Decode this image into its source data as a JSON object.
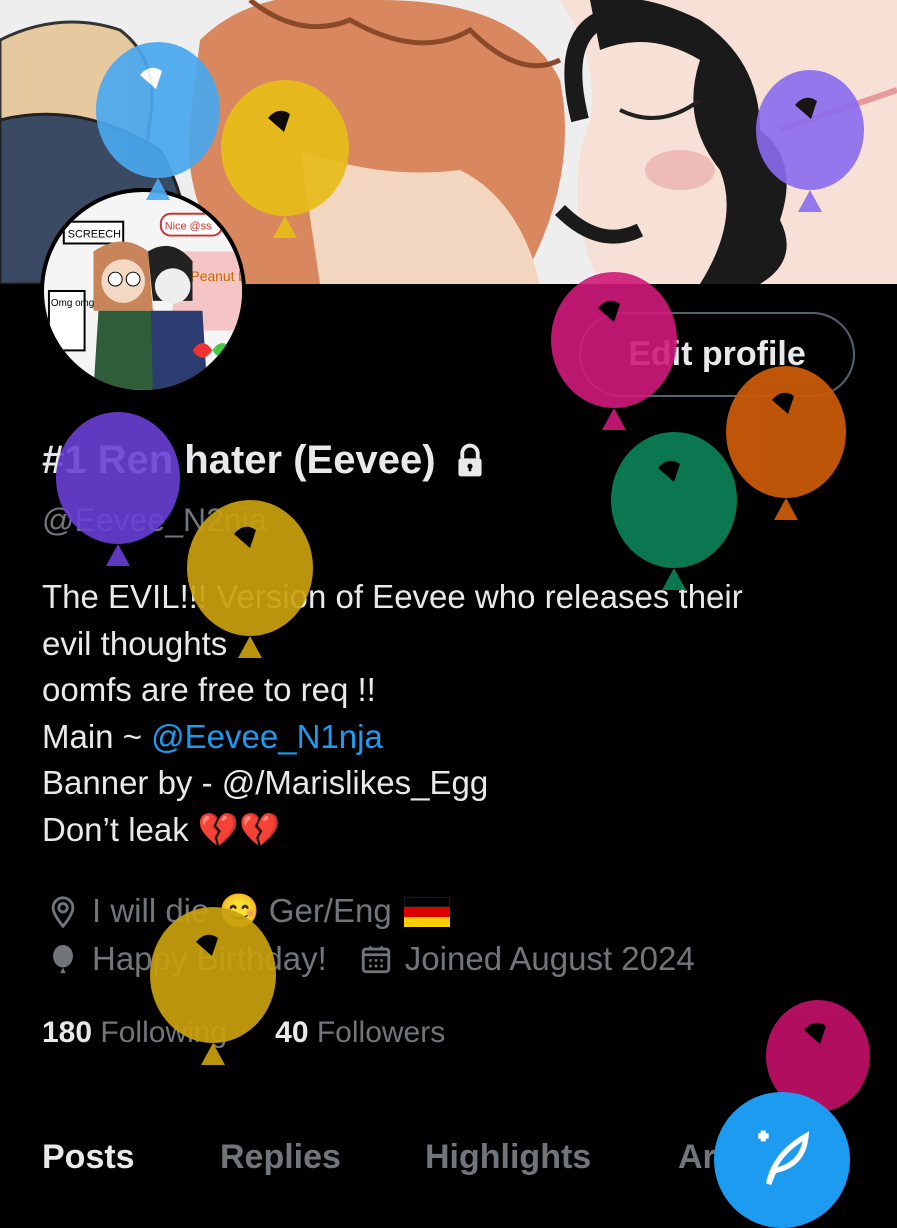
{
  "profile": {
    "edit_label": "Edit profile",
    "display_name": "#1 Ren hater (Eevee)",
    "handle": "@Eevee_N2nja",
    "bio_line1": "The EVIL!!! Version of Eevee who releases their",
    "bio_line2": "evil thoughts",
    "bio_line3": "oomfs are free to req !!",
    "bio_main_prefix": "Main ~ ",
    "bio_main_link": "@Eevee_N1nja",
    "bio_line5": "Banner by - @/Marislikes_Egg",
    "bio_line6": "Don’t leak 💔💔",
    "location": "I will die 😊 Ger/Eng",
    "birthday": "Happy Birthday!",
    "joined": "Joined August 2024",
    "following_count": "180",
    "following_label": "Following",
    "followers_count": "40",
    "followers_label": "Followers"
  },
  "avatar_text": {
    "screech": "SCREECH",
    "nice": "Nice @ss",
    "peanut": "Peanut bread",
    "omg": "Omg omg omg omg"
  },
  "tabs": [
    "Posts",
    "Replies",
    "Highlights",
    "Ar"
  ],
  "colors": {
    "background": "#000000",
    "accent": "#1d9bf0",
    "secondary_text": "#71767b"
  },
  "icons": [
    "lock-icon",
    "location-pin-icon",
    "balloon-icon",
    "calendar-icon",
    "compose-post-icon"
  ]
}
